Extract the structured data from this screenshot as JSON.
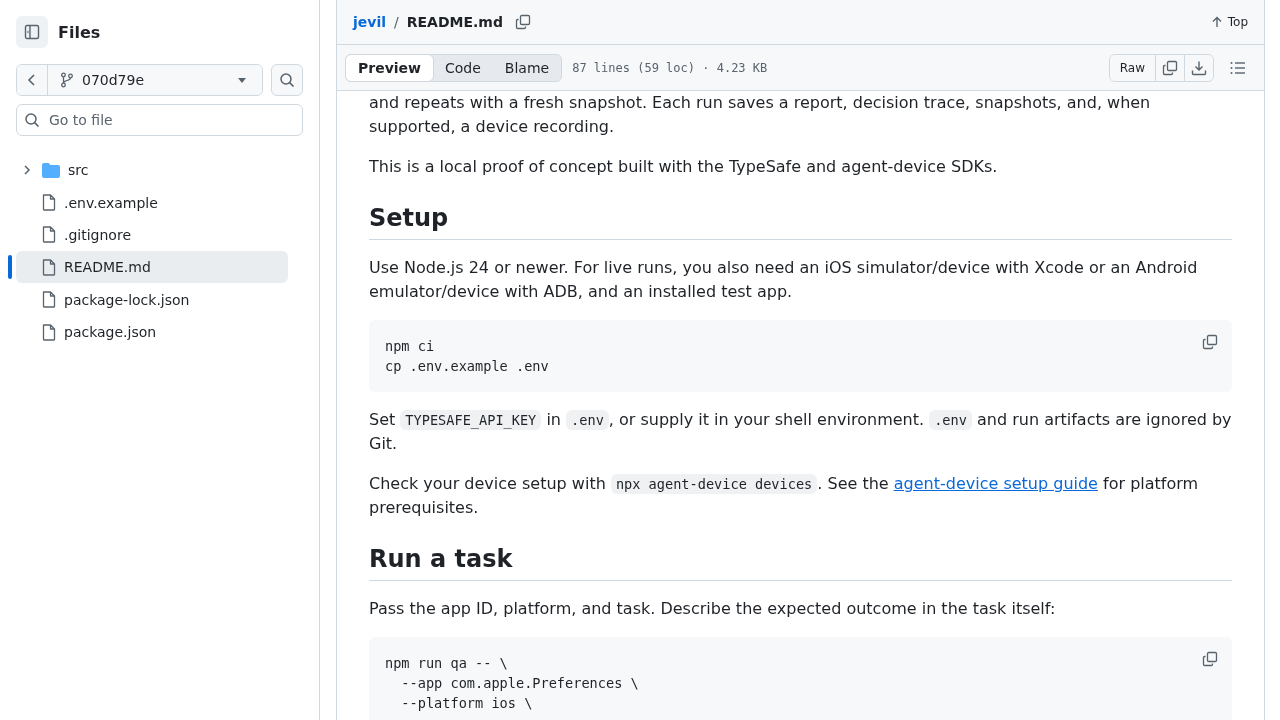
{
  "sidebar": {
    "title": "Files",
    "branch": "070d79e",
    "search": {
      "placeholder": "Go to file"
    },
    "tree": [
      {
        "name": "src",
        "kind": "folder",
        "expanded": false,
        "selected": false
      },
      {
        "name": ".env.example",
        "kind": "file",
        "selected": false
      },
      {
        "name": ".gitignore",
        "kind": "file",
        "selected": false
      },
      {
        "name": "README.md",
        "kind": "file",
        "selected": true
      },
      {
        "name": "package-lock.json",
        "kind": "file",
        "selected": false
      },
      {
        "name": "package.json",
        "kind": "file",
        "selected": false
      }
    ]
  },
  "breadcrumb": {
    "repo": "jevil",
    "separator": "/",
    "file": "README.md"
  },
  "top_link": "Top",
  "tabs": [
    {
      "label": "Preview",
      "selected": true
    },
    {
      "label": "Code",
      "selected": false
    },
    {
      "label": "Blame",
      "selected": false
    }
  ],
  "file_info": "87 lines (59 loc) · 4.23 KB",
  "raw_button": "Raw",
  "content": [
    {
      "kind": "paragraph",
      "parts": [
        {
          "kind": "text",
          "text": "and repeats with a fresh snapshot. Each run saves a report, decision trace, snapshots, and, when supported, a device recording."
        }
      ]
    },
    {
      "kind": "paragraph",
      "parts": [
        {
          "kind": "text",
          "text": "This is a local proof of concept built with the TypeSafe and agent-device SDKs."
        }
      ]
    },
    {
      "kind": "heading",
      "text": "Setup"
    },
    {
      "kind": "paragraph",
      "parts": [
        {
          "kind": "text",
          "text": "Use Node.js 24 or newer. For live runs, you also need an iOS simulator/device with Xcode or an Android emulator/device with ADB, and an installed test app."
        }
      ]
    },
    {
      "kind": "code",
      "lines": [
        "npm ci",
        "cp .env.example .env"
      ]
    },
    {
      "kind": "paragraph",
      "parts": [
        {
          "kind": "text",
          "text": "Set "
        },
        {
          "kind": "code",
          "text": "TYPESAFE_API_KEY"
        },
        {
          "kind": "text",
          "text": " in "
        },
        {
          "kind": "code",
          "text": ".env"
        },
        {
          "kind": "text",
          "text": ", or supply it in your shell environment. "
        },
        {
          "kind": "code",
          "text": ".env"
        },
        {
          "kind": "text",
          "text": " and run artifacts are ignored by Git."
        }
      ]
    },
    {
      "kind": "paragraph",
      "parts": [
        {
          "kind": "text",
          "text": "Check your device setup with "
        },
        {
          "kind": "code",
          "text": "npx agent-device devices"
        },
        {
          "kind": "text",
          "text": ". See the "
        },
        {
          "kind": "link",
          "text": "agent-device setup guide"
        },
        {
          "kind": "text",
          "text": " for platform prerequisites."
        }
      ]
    },
    {
      "kind": "heading",
      "text": "Run a task"
    },
    {
      "kind": "paragraph",
      "parts": [
        {
          "kind": "text",
          "text": "Pass the app ID, platform, and task. Describe the expected outcome in the task itself:"
        }
      ]
    },
    {
      "kind": "code",
      "lines": [
        "npm run qa -- \\",
        "  --app com.apple.Preferences \\",
        "  --platform ios \\"
      ]
    }
  ]
}
